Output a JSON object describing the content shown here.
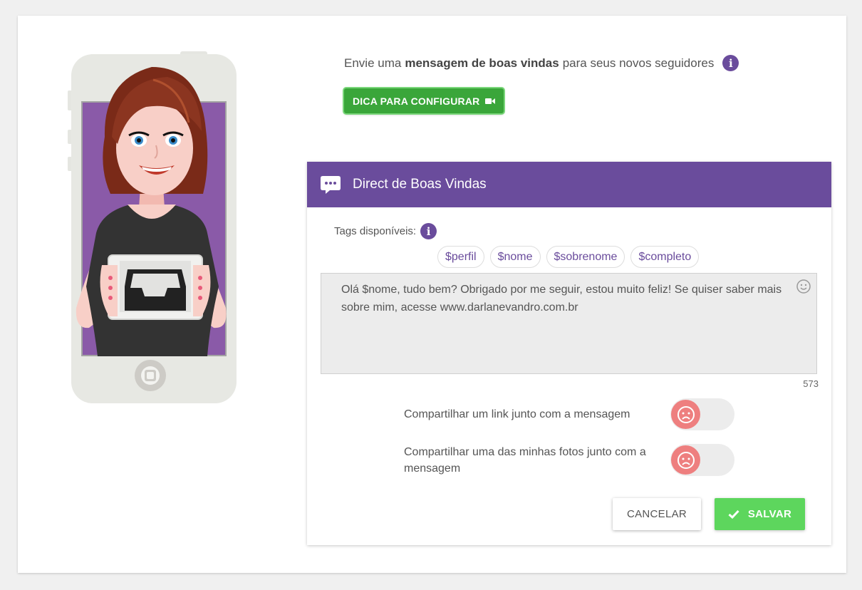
{
  "intro": {
    "prefix": "Envie uma",
    "emphasis": "mensagem de boas vindas",
    "suffix": "para seus novos seguidores"
  },
  "tip_button": {
    "label": "DICA PARA CONFIGURAR"
  },
  "panel": {
    "title": "Direct de Boas Vindas",
    "tags_label": "Tags disponíveis:",
    "tags": [
      "$perfil",
      "$nome",
      "$sobrenome",
      "$completo"
    ],
    "message": "Olá $nome, tudo bem? Obrigado por me seguir, estou muito feliz! Se quiser saber mais sobre mim, acesse www.darlanevandro.com.br",
    "char_count": "573",
    "options": [
      {
        "label": "Compartilhar um link junto com a mensagem",
        "enabled": false
      },
      {
        "label": "Compartilhar uma das minhas fotos junto com a mensagem",
        "enabled": false
      }
    ],
    "cancel_label": "CANCELAR",
    "save_label": "SALVAR"
  },
  "colors": {
    "accent_purple": "#6a4c9c",
    "tip_green": "#3aa63a",
    "save_green": "#5dd65d",
    "toggle_off": "#ee7f7f"
  }
}
